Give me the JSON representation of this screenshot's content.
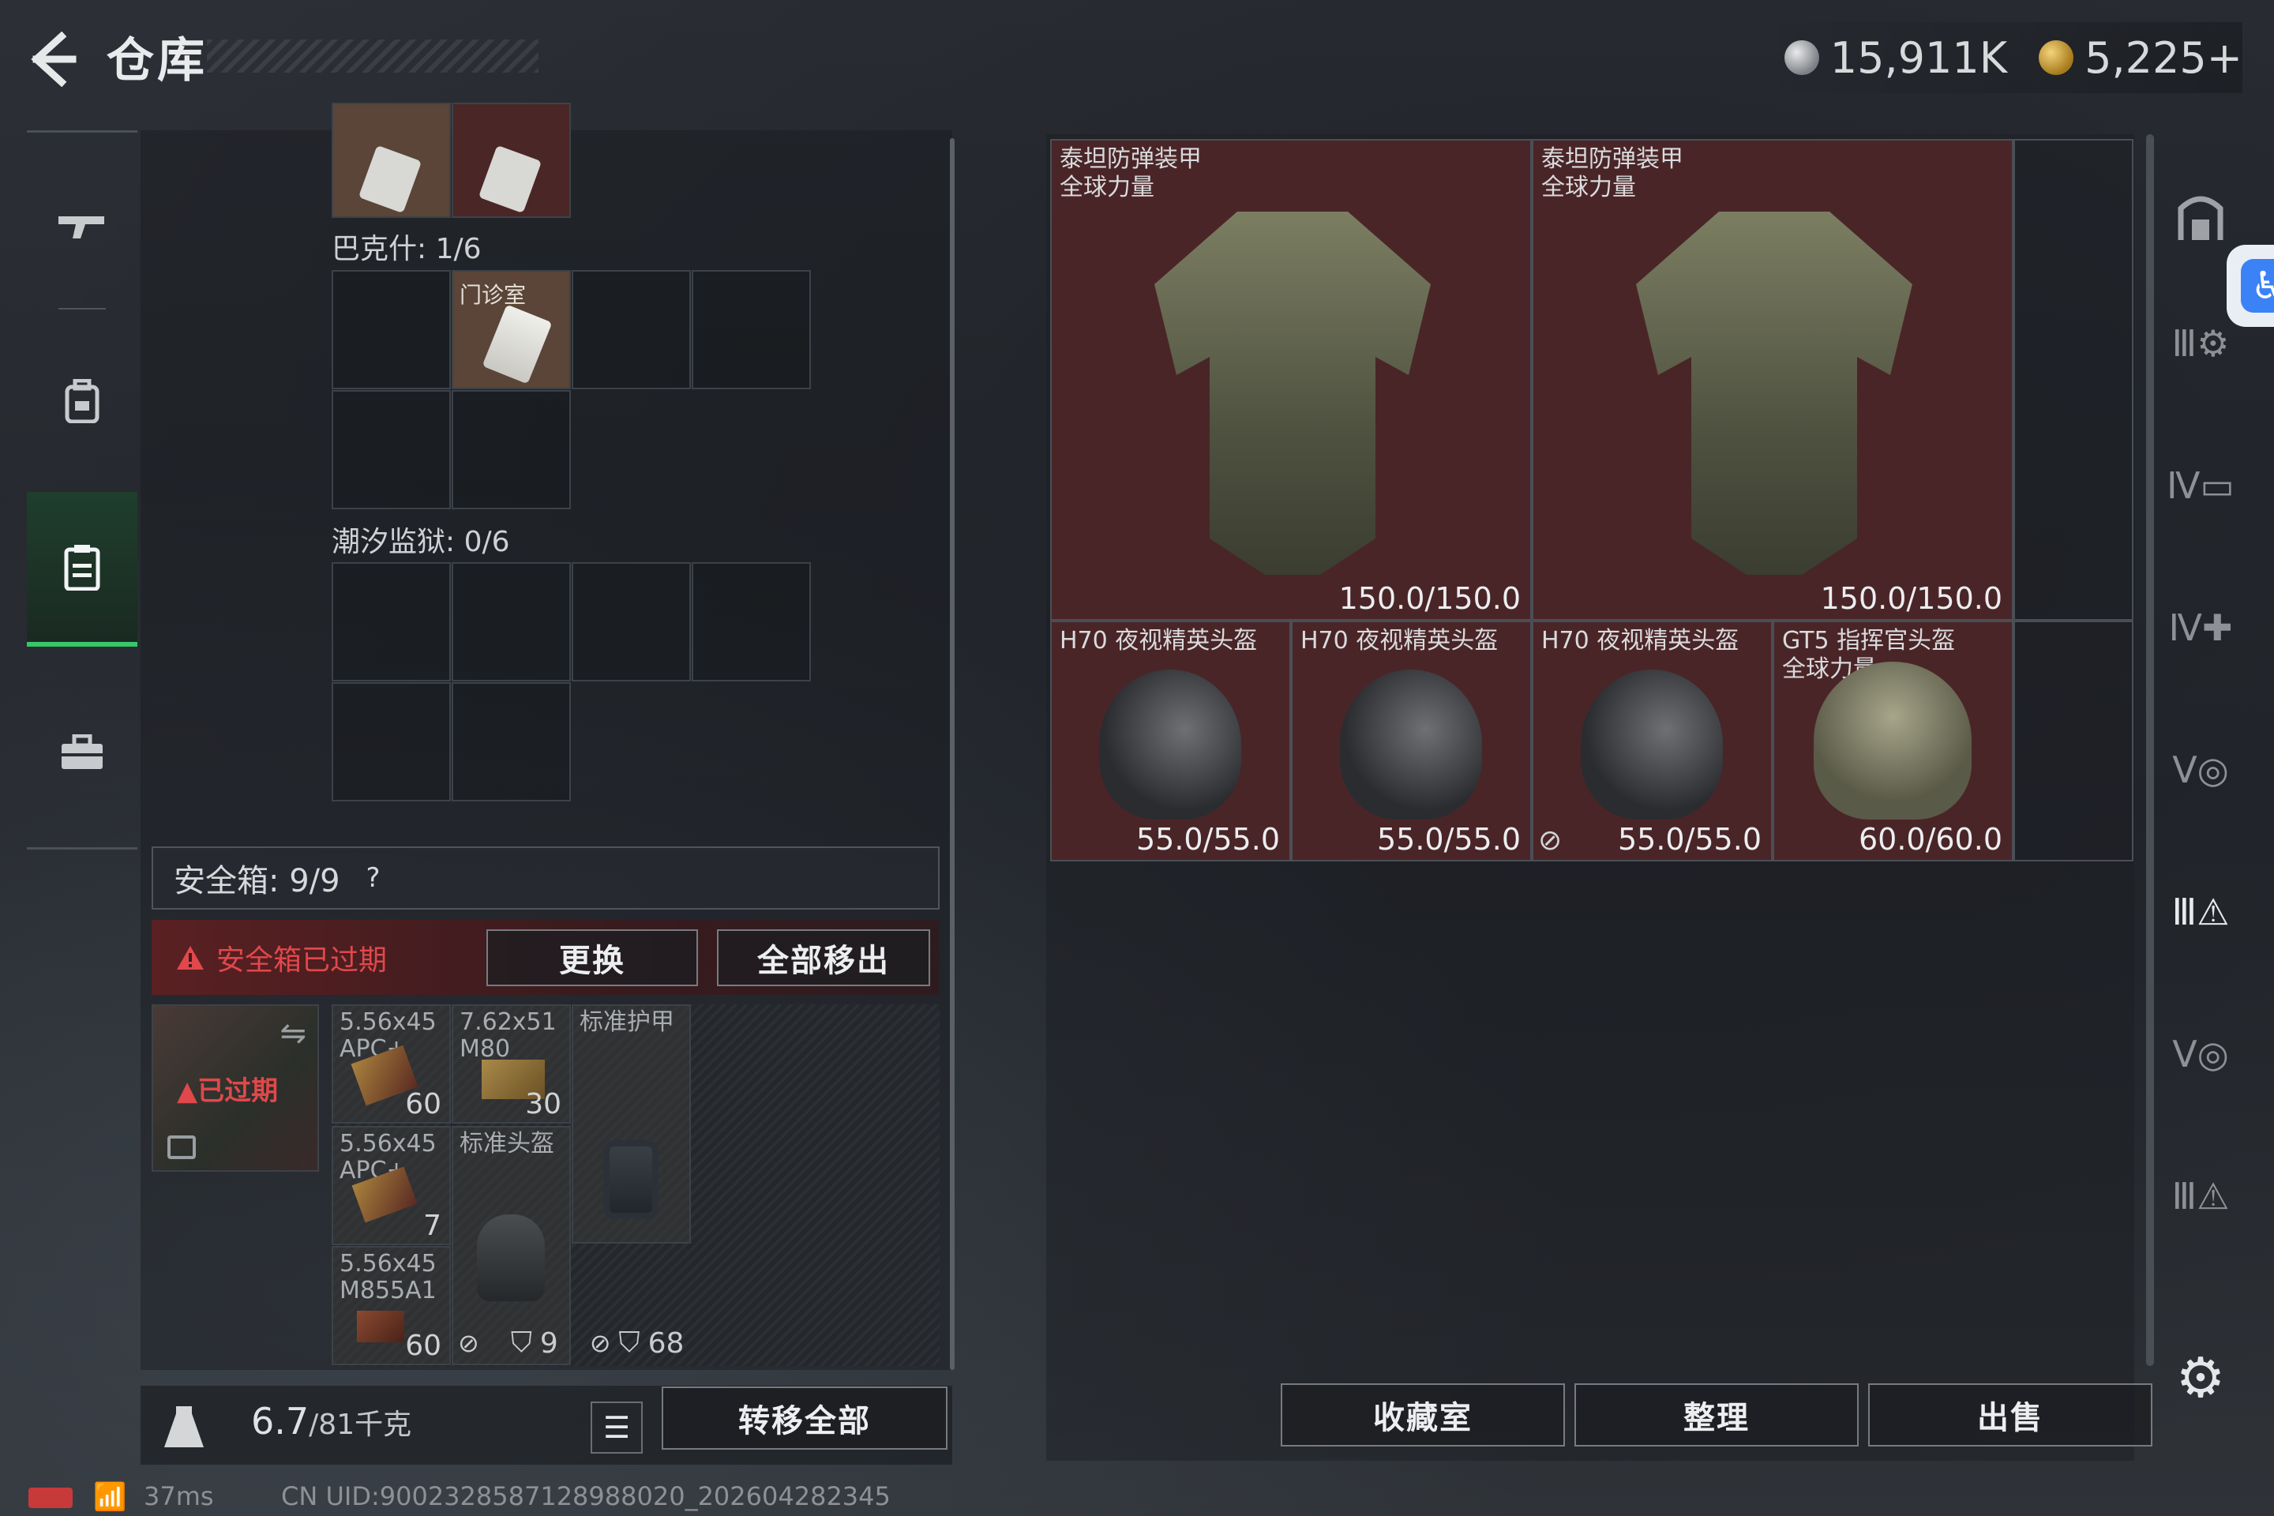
{
  "header": {
    "title": "仓库",
    "currency_silver": "15,911K",
    "currency_gold": "5,225+"
  },
  "storage": {
    "sections": [
      {
        "label": "巴克什: 1/6"
      },
      {
        "label": "潮汐监狱: 0/6"
      }
    ],
    "card_label": "门诊室"
  },
  "safe_box": {
    "header": "安全箱: 9/9",
    "help": "?",
    "expired_warning": "安全箱已过期",
    "replace_button": "更换",
    "remove_all_button": "全部移出",
    "case_status": "已过期",
    "items": [
      {
        "name": "5.56x45 APC+",
        "count": "60"
      },
      {
        "name": "7.62x51 M80",
        "count": "30"
      },
      {
        "name": "标准护甲",
        "count": ""
      },
      {
        "name": "5.56x45 APC+",
        "count": "7"
      },
      {
        "name": "标准头盔",
        "count": ""
      },
      {
        "name": "5.56x45 M855A1",
        "count": "60"
      }
    ],
    "armor_value": "9",
    "helmet_value": "68"
  },
  "footer": {
    "weight_current": "6.7",
    "weight_max": "/81千克",
    "transfer_all_button": "转移全部"
  },
  "inventory": {
    "armors": [
      {
        "name": "泰坦防弹装甲",
        "subtitle": "全球力量",
        "durability": "150.0/150.0"
      },
      {
        "name": "泰坦防弹装甲",
        "subtitle": "全球力量",
        "durability": "150.0/150.0"
      }
    ],
    "helmets": [
      {
        "name": "H70 夜视精英头盔",
        "subtitle": "",
        "durability": "55.0/55.0"
      },
      {
        "name": "H70 夜视精英头盔",
        "subtitle": "",
        "durability": "55.0/55.0"
      },
      {
        "name": "H70 夜视精英头盔",
        "subtitle": "",
        "durability": "55.0/55.0"
      },
      {
        "name": "GT5 指挥官头盔",
        "subtitle": "全球力量",
        "durability": "60.0/60.0"
      }
    ]
  },
  "actions": {
    "collection_button": "收藏室",
    "sort_button": "整理",
    "sell_button": "出售"
  },
  "status_bar": {
    "ping": "37ms",
    "uid": "CN UID:9002328587128988020_202604282345"
  },
  "colors": {
    "accent_green": "#35c76a",
    "danger_red": "#e0484b",
    "armor_bg": "#4a2527",
    "accessibility_blue": "#3b82f6"
  }
}
